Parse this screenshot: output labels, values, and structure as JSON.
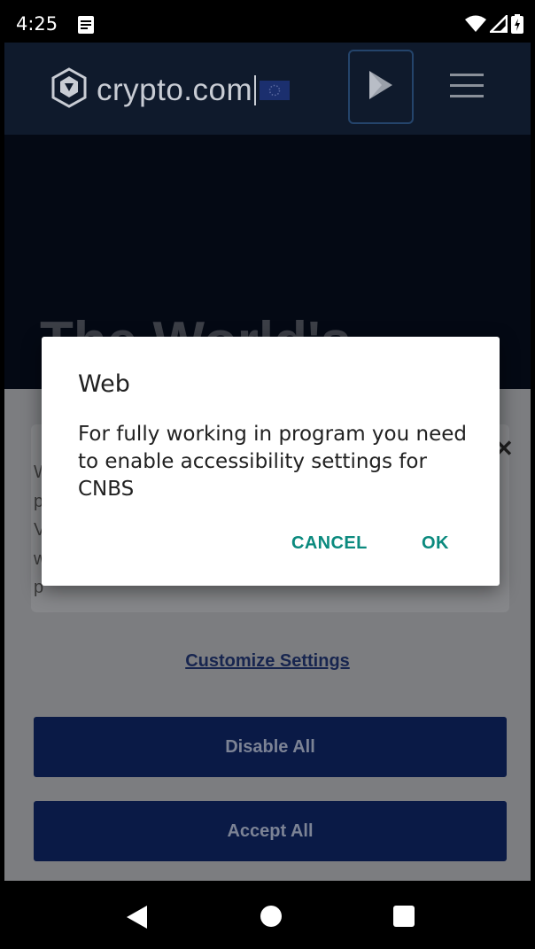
{
  "statusbar": {
    "time": "4:25"
  },
  "header": {
    "brand": "crypto.com"
  },
  "hero": {
    "title": "The World's"
  },
  "cookie": {
    "text_fragment": "W\np\nV\nw\np",
    "customize_label": "Customize Settings",
    "disable_label": "Disable All",
    "accept_label": "Accept All"
  },
  "dialog": {
    "title": "Web",
    "message": "For fully working in program you need to enable accessibility settings for CNBS",
    "cancel_label": "CANCEL",
    "ok_label": "OK"
  },
  "colors": {
    "accent": "#0b8a7e",
    "header_bg": "#0f1a2c",
    "button_bg": "#0a1a46"
  },
  "icons": [
    "notification-icon",
    "wifi-icon",
    "signal-icon",
    "battery-icon",
    "crypto-logo-icon",
    "eu-flag-icon",
    "play-store-icon",
    "menu-icon",
    "close-icon",
    "back-icon",
    "home-icon",
    "recents-icon"
  ]
}
